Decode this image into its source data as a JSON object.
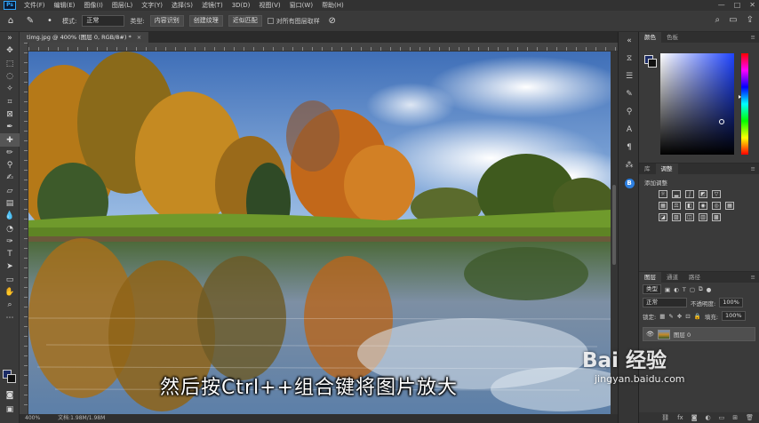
{
  "menubar": {
    "logo": "Ps",
    "items": [
      "文件(F)",
      "编辑(E)",
      "图像(I)",
      "图层(L)",
      "文字(Y)",
      "选择(S)",
      "滤镜(T)",
      "3D(D)",
      "视图(V)",
      "窗口(W)",
      "帮助(H)"
    ],
    "window_controls": [
      "—",
      "□",
      "✕"
    ]
  },
  "options": {
    "mode_label": "模式:",
    "mode_value": "正常",
    "type_label": "类型:",
    "type_buttons": [
      "内容识别",
      "创建纹理",
      "近似匹配"
    ],
    "sample_all_layers": "对所有图层取样"
  },
  "document": {
    "tab_title": "timg.jpg @ 400% (图层 0, RGB/8#) *",
    "zoom": "400%",
    "doc_info": "文档:1.98M/1.98M"
  },
  "caption": "然后按Ctrl++组合键将图片放大",
  "panels": {
    "color_tabs": [
      "颜色",
      "色板"
    ],
    "adjust_tabs": [
      "库",
      "调整"
    ],
    "adjust_label": "添加调整",
    "layers_tabs": [
      "图层",
      "通道",
      "路径"
    ],
    "filter_kind": "类型",
    "blend_mode": "正常",
    "opacity_label": "不透明度:",
    "opacity_value": "100%",
    "lock_label": "锁定:",
    "fill_label": "填充:",
    "fill_value": "100%",
    "layer_name": "图层 0"
  },
  "watermark": {
    "logo_text": "Bai 经验",
    "url": "jingyan.baidu.com"
  },
  "colors": {
    "foreground": "#1b2b66",
    "background": "#111111",
    "accent": "#31a8ff"
  }
}
